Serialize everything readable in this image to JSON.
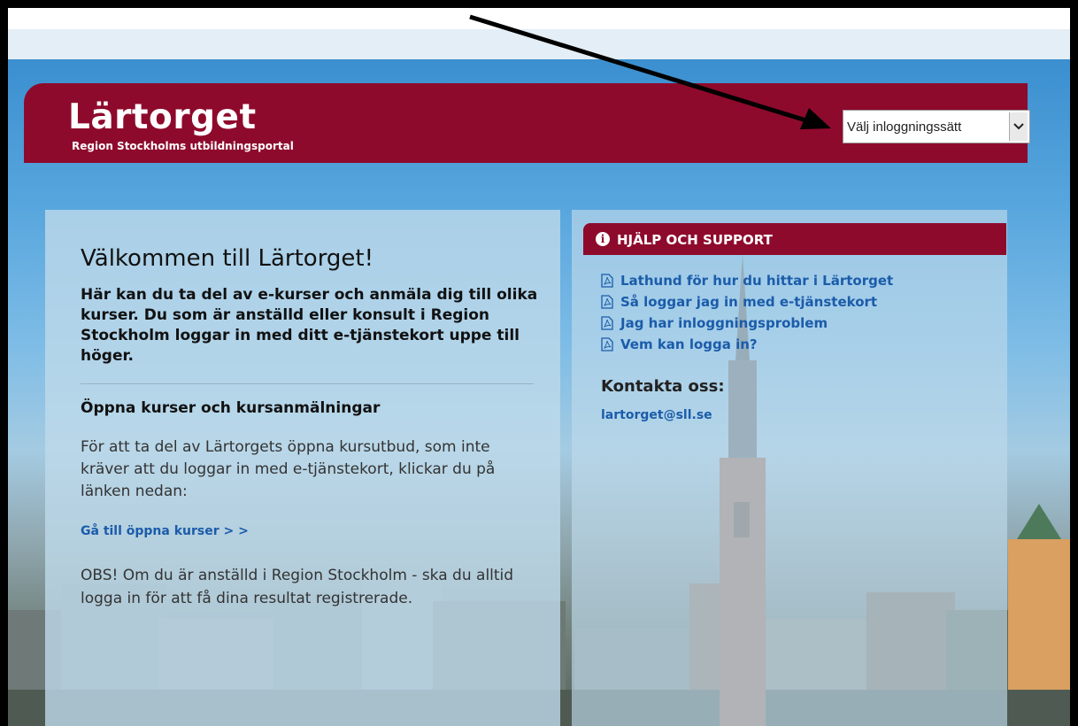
{
  "header": {
    "title": "Lärtorget",
    "subtitle": "Region Stockholms utbildningsportal",
    "login_select": {
      "value": "Välj inloggningssätt",
      "icon": "chevron-down-icon"
    }
  },
  "welcome": {
    "heading": "Välkommen till Lärtorget!",
    "intro": "Här kan du ta del av e-kurser och anmäla dig till olika kurser. Du som är anställd eller konsult i Region Stockholm loggar in med ditt e-tjänstekort uppe till höger.",
    "open_heading": "Öppna kurser och kursanmälningar",
    "open_text": "För att ta del av Lärtorgets öppna kursutbud, som inte kräver att du loggar in med e-tjänstekort, klickar du på länken nedan:",
    "open_link": "Gå till öppna kurser > >",
    "obs_text": "OBS! Om du är anställd i Region Stockholm - ska du alltid logga in för att få dina resultat registrerade."
  },
  "help": {
    "title": "HJÄLP OCH SUPPORT",
    "icon": "info-icon",
    "links": [
      {
        "label": "Lathund för hur du hittar i Lärtorget",
        "icon": "pdf-icon"
      },
      {
        "label": "Så loggar jag in med e-tjänstekort",
        "icon": "pdf-icon"
      },
      {
        "label": "Jag har inloggningsproblem",
        "icon": "pdf-icon"
      },
      {
        "label": "Vem kan logga in?",
        "icon": "pdf-icon"
      }
    ],
    "contact_heading": "Kontakta oss:",
    "contact_email": "lartorget@sll.se"
  },
  "colors": {
    "brand": "#8e0a2c",
    "link": "#1b5caa",
    "sky": "#58a6de"
  }
}
